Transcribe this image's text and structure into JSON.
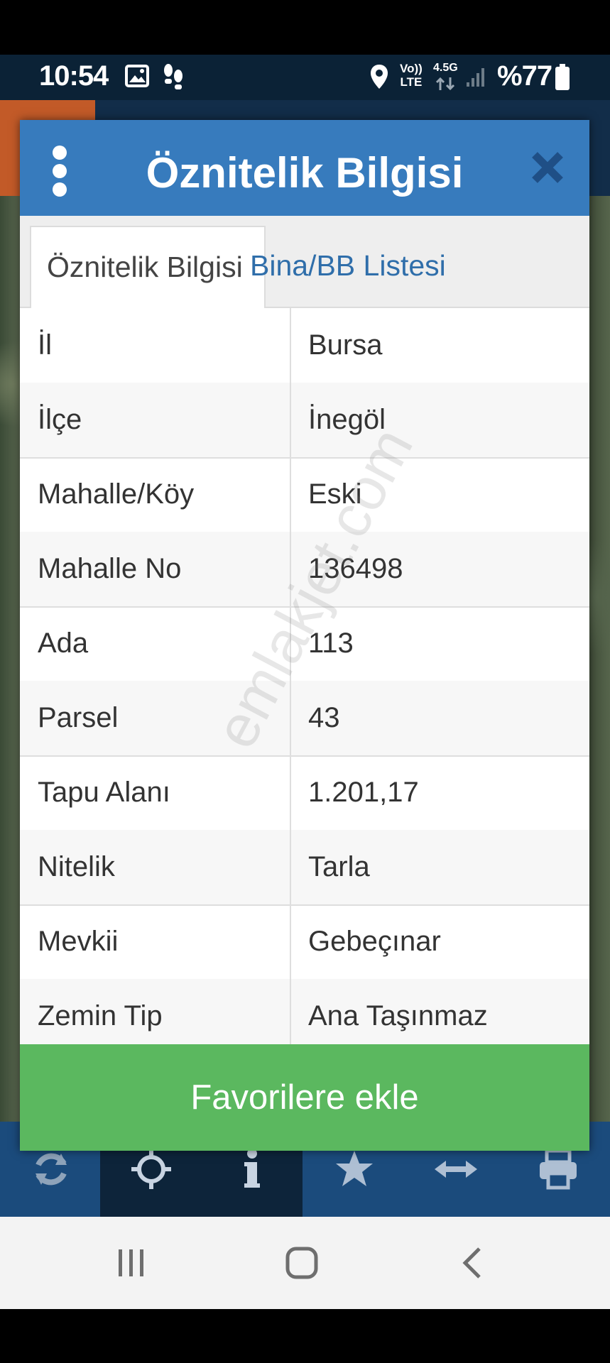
{
  "status_bar": {
    "time": "10:54",
    "network_top": "Vo))",
    "network_bottom": "LTE",
    "data_type": "4.5G",
    "battery": "%77"
  },
  "dialog": {
    "title": "Öznitelik Bilgisi",
    "tabs": [
      {
        "label": "Öznitelik Bilgisi",
        "active": true
      },
      {
        "label": "Bina/BB Listesi",
        "active": false
      }
    ],
    "rows": [
      {
        "label": "İl",
        "value": "Bursa"
      },
      {
        "label": "İlçe",
        "value": "İnegöl"
      },
      {
        "label": "Mahalle/Köy",
        "value": "Eski"
      },
      {
        "label": "Mahalle No",
        "value": "136498"
      },
      {
        "label": "Ada",
        "value": "113"
      },
      {
        "label": "Parsel",
        "value": "43"
      },
      {
        "label": "Tapu Alanı",
        "value": "1.201,17"
      },
      {
        "label": "Nitelik",
        "value": "Tarla"
      },
      {
        "label": "Mevkii",
        "value": "Gebeçınar"
      },
      {
        "label": "Zemin Tip",
        "value": "Ana Taşınmaz"
      }
    ],
    "favorite_button": "Favorilere ekle"
  },
  "watermark": "emlakjet.com",
  "toolbar": {
    "icons": [
      "refresh-icon",
      "crosshair-icon",
      "info-icon",
      "star-icon",
      "arrows-horizontal-icon",
      "print-icon"
    ]
  },
  "colors": {
    "header_blue": "#377bbd",
    "favorite_green": "#5bb85f",
    "tab_link_blue": "#2f6eaa"
  }
}
